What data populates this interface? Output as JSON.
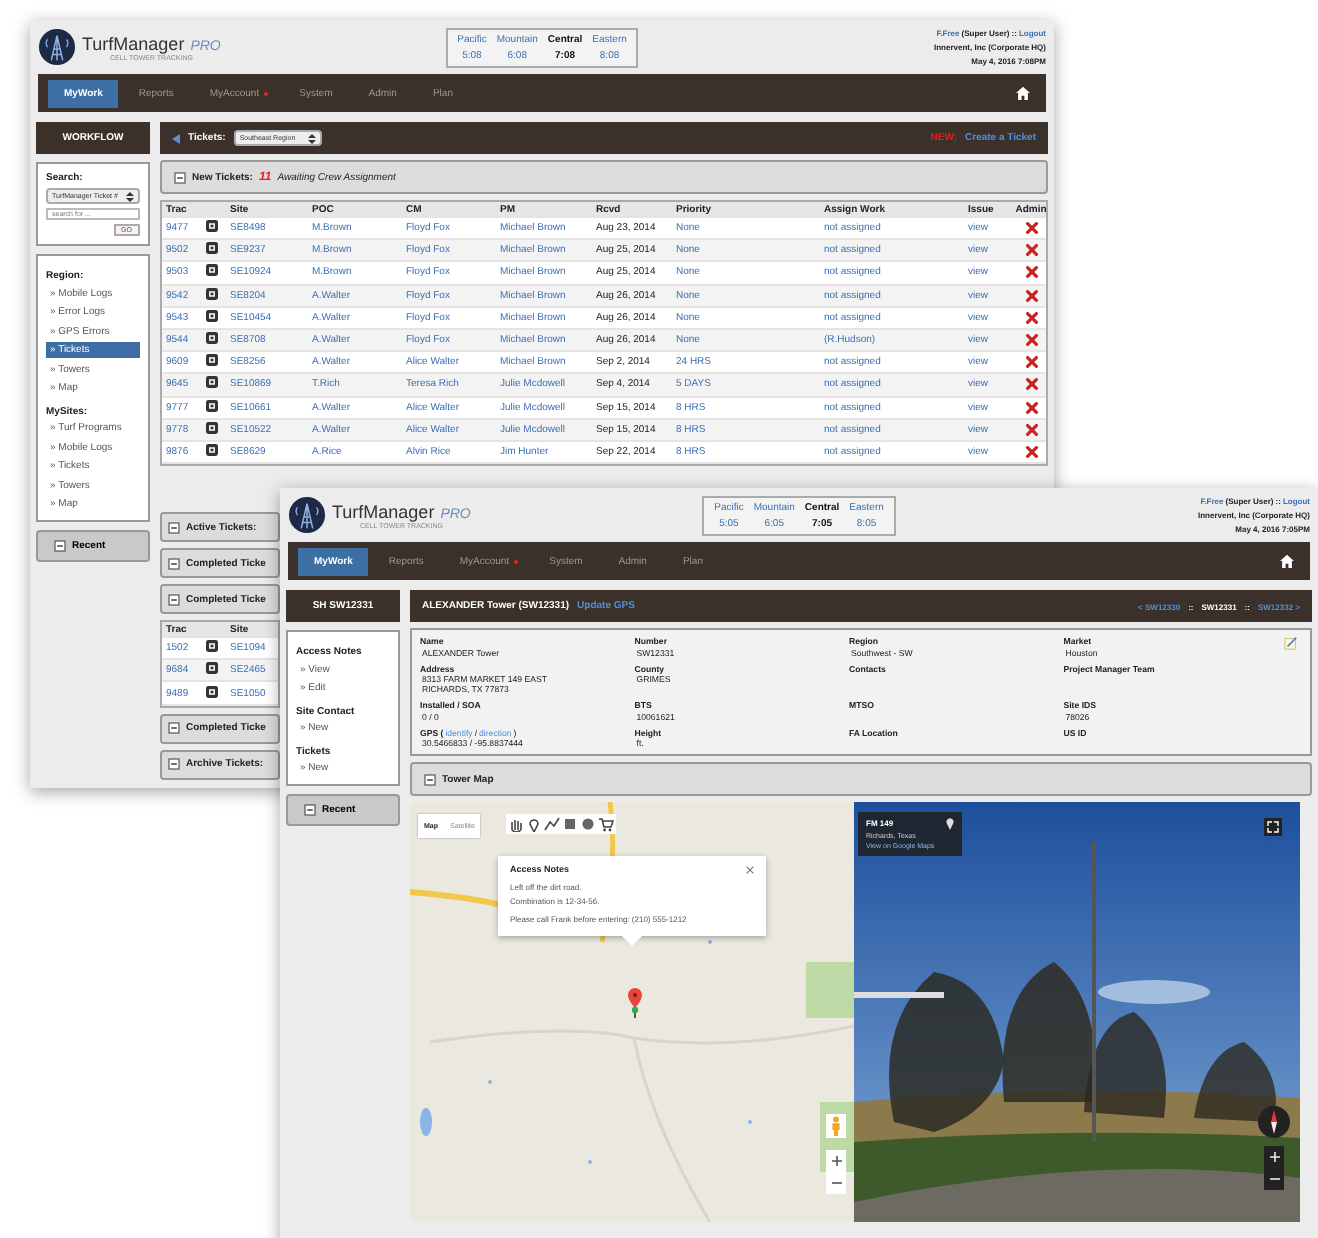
{
  "back_window": {
    "header": {
      "brand": "TurfManager",
      "edition": "PRO",
      "tagline": "CELL TOWER TRACKING",
      "time_zones": [
        {
          "zone": "Pacific",
          "time": "5:08",
          "selected": false
        },
        {
          "zone": "Mountain",
          "time": "6:08",
          "selected": false
        },
        {
          "zone": "Central",
          "time": "7:08",
          "selected": true
        },
        {
          "zone": "Eastern",
          "time": "8:08",
          "selected": false
        }
      ],
      "user": "F.Free",
      "role": "(Super User)",
      "separator": "::",
      "logout": "Logout",
      "company": "Innervent, Inc (Corporate HQ)",
      "datetime": "May 4, 2016 7:08PM"
    },
    "nav": [
      {
        "label": "MyWork",
        "selected": true,
        "alert": false
      },
      {
        "label": "Reports",
        "selected": false,
        "alert": false
      },
      {
        "label": "MyAccount",
        "selected": false,
        "alert": true
      },
      {
        "label": "System",
        "selected": false,
        "alert": false
      },
      {
        "label": "Admin",
        "selected": false,
        "alert": false
      },
      {
        "label": "Plan",
        "selected": false,
        "alert": false
      }
    ],
    "sidebar": {
      "title": "WORKFLOW",
      "search": {
        "label": "Search:",
        "type": "TurfManager Ticket #",
        "placeholder": "search for ...",
        "button": "GO"
      },
      "groups": [
        {
          "title": "Region:",
          "items": [
            {
              "label": "» Mobile Logs",
              "selected": false
            },
            {
              "label": "» Error Logs",
              "selected": false
            },
            {
              "label": "» GPS Errors",
              "selected": false
            },
            {
              "label": "» Tickets",
              "selected": true
            },
            {
              "label": "» Towers",
              "selected": false
            },
            {
              "label": "» Map",
              "selected": false
            }
          ]
        },
        {
          "title": "MySites:",
          "items": [
            {
              "label": "» Turf Programs",
              "selected": false
            },
            {
              "label": "» Mobile Logs",
              "selected": false
            },
            {
              "label": "» Tickets",
              "selected": false
            },
            {
              "label": "» Towers",
              "selected": false
            },
            {
              "label": "» Map",
              "selected": false
            }
          ]
        }
      ],
      "recent": "Recent"
    },
    "tickets_bar": {
      "label": "Tickets:",
      "region": "Southeast Region",
      "new_label": "NEW:",
      "create": "Create a Ticket"
    },
    "sections": [
      {
        "title": "New Tickets:",
        "count": "11",
        "subtitle": "Awaiting Crew Assignment",
        "table": {
          "columns": [
            {
              "label": "Trac",
              "kind": "link"
            },
            {
              "kind": "icon"
            },
            {
              "label": "Site",
              "kind": "link"
            },
            {
              "label": "POC",
              "kind": "link"
            },
            {
              "label": "CM",
              "kind": "link"
            },
            {
              "label": "PM",
              "kind": "link"
            },
            {
              "label": "Rcvd",
              "kind": "text"
            },
            {
              "label": "Priority",
              "kind": "link"
            },
            {
              "label": "Assign Work",
              "kind": "link"
            },
            {
              "label": "Issue",
              "kind": "link"
            },
            {
              "label": "Admin",
              "kind": "delete"
            }
          ],
          "rows": [
            [
              "9477",
              "",
              "SE8498",
              "M.Brown",
              "Floyd Fox",
              "Michael Brown",
              "Aug 23, 2014",
              "None",
              "not assigned",
              "view"
            ],
            [
              "9502",
              "",
              "SE9237",
              "M.Brown",
              "Floyd Fox",
              "Michael Brown",
              "Aug 25, 2014",
              "None",
              "not assigned",
              "view"
            ],
            [
              "9503",
              "",
              "SE10924",
              "M.Brown",
              "Floyd Fox",
              "Michael Brown",
              "Aug 25, 2014",
              "None",
              "not assigned",
              "view"
            ],
            [
              "9542",
              "",
              "SE8204",
              "A.Walter",
              "Floyd Fox",
              "Michael Brown",
              "Aug 26, 2014",
              "None",
              "not assigned",
              "view"
            ],
            [
              "9543",
              "",
              "SE10454",
              "A.Walter",
              "Floyd Fox",
              "Michael Brown",
              "Aug 26, 2014",
              "None",
              "not assigned",
              "view"
            ],
            [
              "9544",
              "",
              "SE8708",
              "A.Walter",
              "Floyd Fox",
              "Michael Brown",
              "Aug 26, 2014",
              "None",
              "(R.Hudson)",
              "view"
            ],
            [
              "9609",
              "",
              "SE8256",
              "A.Walter",
              "Alice Walter",
              "Michael Brown",
              "Sep 2, 2014",
              "24 HRS",
              "not assigned",
              "view"
            ],
            [
              "9645",
              "",
              "SE10869",
              "T.Rich",
              "Teresa Rich",
              "Julie Mcdowell",
              "Sep 4, 2014",
              "5 DAYS",
              "not assigned",
              "view"
            ],
            [
              "9777",
              "",
              "SE10661",
              "A.Walter",
              "Alice Walter",
              "Julie Mcdowell",
              "Sep 15, 2014",
              "8 HRS",
              "not assigned",
              "view"
            ],
            [
              "9778",
              "",
              "SE10522",
              "A.Walter",
              "Alice Walter",
              "Julie Mcdowell",
              "Sep 15, 2014",
              "8 HRS",
              "not assigned",
              "view"
            ],
            [
              "9876",
              "",
              "SE8629",
              "A.Rice",
              "Alvin Rice",
              "Jim Hunter",
              "Sep 22, 2014",
              "8 HRS",
              "not assigned",
              "view"
            ]
          ]
        }
      },
      {
        "title": "Active Tickets:"
      },
      {
        "title": "Completed Ticke"
      },
      {
        "title": "Completed Ticke",
        "table": {
          "columns": [
            {
              "label": "Trac",
              "kind": "link"
            },
            {
              "kind": "icon"
            },
            {
              "label": "Site",
              "kind": "link"
            }
          ],
          "rows": [
            [
              "1502",
              "",
              "SE1094"
            ],
            [
              "9684",
              "",
              "SE2465"
            ],
            [
              "9489",
              "",
              "SE1050"
            ]
          ]
        }
      },
      {
        "title": "Completed Ticke"
      },
      {
        "title": "Archive Tickets:"
      }
    ]
  },
  "front_window": {
    "header": {
      "brand": "TurfManager",
      "edition": "PRO",
      "tagline": "CELL TOWER TRACKING",
      "time_zones": [
        {
          "zone": "Pacific",
          "time": "5:05",
          "selected": false
        },
        {
          "zone": "Mountain",
          "time": "6:05",
          "selected": false
        },
        {
          "zone": "Central",
          "time": "7:05",
          "selected": true
        },
        {
          "zone": "Eastern",
          "time": "8:05",
          "selected": false
        }
      ],
      "user": "F.Free",
      "role": "(Super User)",
      "separator": "::",
      "logout": "Logout",
      "company": "Innervent, Inc (Corporate HQ)",
      "datetime": "May 4, 2016 7:05PM"
    },
    "nav": [
      {
        "label": "MyWork",
        "selected": true,
        "alert": false
      },
      {
        "label": "Reports",
        "selected": false,
        "alert": false
      },
      {
        "label": "MyAccount",
        "selected": false,
        "alert": true
      },
      {
        "label": "System",
        "selected": false,
        "alert": false
      },
      {
        "label": "Admin",
        "selected": false,
        "alert": false
      },
      {
        "label": "Plan",
        "selected": false,
        "alert": false
      }
    ],
    "sidebar": {
      "title": "SH SW12331",
      "groups": [
        {
          "title": "Access Notes",
          "links": [
            "» View",
            "» Edit"
          ]
        },
        {
          "title": "Site Contact",
          "links": [
            "» New"
          ]
        },
        {
          "title": "Tickets",
          "links": [
            "» New"
          ]
        }
      ],
      "recent": "Recent"
    },
    "site_title": "ALEXANDER Tower (SW12331)",
    "update_gps": "Update GPS",
    "pager": [
      {
        "text": "< SW12330",
        "kind": "link"
      },
      {
        "text": "::",
        "kind": "sep"
      },
      {
        "text": "SW12331",
        "kind": "current"
      },
      {
        "text": "::",
        "kind": "sep"
      },
      {
        "text": "SW12332 >",
        "kind": "link"
      }
    ],
    "fields": [
      {
        "label": "Name",
        "value": "ALEXANDER Tower"
      },
      {
        "label": "Number",
        "value": "SW12331"
      },
      {
        "label": "Region",
        "value": "Southwest - SW"
      },
      {
        "label": "Market",
        "value": "Houston"
      },
      {
        "label": "Address",
        "value": "8313 FARM MARKET 149 EAST\nRICHARDS, TX 77873"
      },
      {
        "label": "County",
        "value": "GRIMES"
      },
      {
        "label": "Contacts"
      },
      {
        "label": "Project Manager Team"
      },
      {
        "label": "Installed / SOA",
        "value": "0 / 0"
      },
      {
        "label": "BTS",
        "value": "10061621"
      },
      {
        "label": "MTSO"
      },
      {
        "label": "Site IDS",
        "value": "78026"
      },
      {
        "label": "GPS (",
        "links": [
          "identify",
          "direction"
        ],
        "link_separator": "/",
        "label_end": ")",
        "value": "30.5466833 / -95.8837444"
      },
      {
        "label": "Height",
        "value": "ft."
      },
      {
        "label": "FA Location"
      },
      {
        "label": "US ID"
      }
    ],
    "map_section": "Tower Map",
    "map": {
      "map_types": [
        {
          "label": "Map",
          "selected": true
        },
        {
          "label": "Satellite",
          "selected": false
        }
      ],
      "popup": {
        "title": "Access Notes",
        "paragraphs": [
          [
            "Left off the dirt road.",
            "Combination is 12-34-56."
          ],
          [
            "Please call Frank before entering: (210) 555-1212"
          ]
        ]
      }
    },
    "street_view": {
      "title": "FM 149",
      "subtitle": "Richards, Texas",
      "link": "View on Google Maps"
    }
  }
}
